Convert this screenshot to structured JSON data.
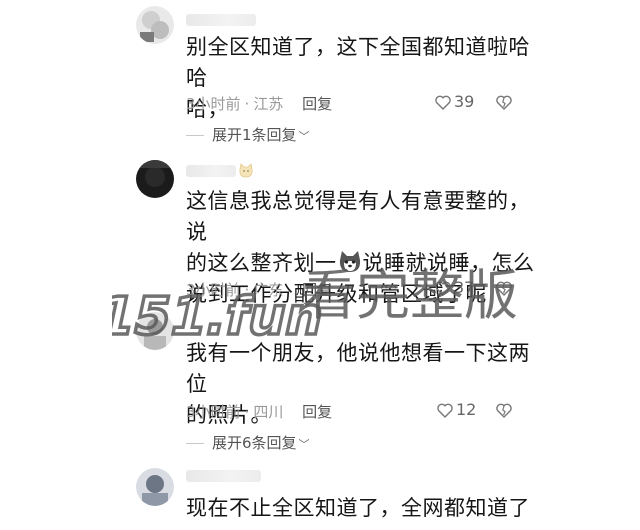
{
  "comments": [
    {
      "text_lines": [
        "别全区知道了，这下全国都知道啦哈哈",
        "哈，"
      ],
      "time": "3小时前",
      "location": "江苏",
      "reply_label": "回复",
      "likes": "39",
      "expand_label": "展开1条回复"
    },
    {
      "text_lines": [
        "这信息我总觉得是有人有意要整的，说",
        "的这么整齐划一",
        "说睡就说睡，怎么",
        "说到工作分配升级和管区域了呢"
      ],
      "time": "3小时前",
      "location": "广东",
      "reply_label": "回复",
      "likes": "37"
    },
    {
      "text_lines": [
        "我有一个朋友，他说他想看一下这两位",
        "的照片。"
      ],
      "time": "3小时前",
      "location": "四川",
      "reply_label": "回复",
      "likes": "12",
      "expand_label": "展开6条回复"
    },
    {
      "text_lines": [
        "现在不止全区知道了，全网都知道了"
      ]
    }
  ],
  "meta_separator": "·",
  "watermark": {
    "site": "151.fun",
    "slogan": "看完整版"
  },
  "icons": {
    "like": "heart-outline-icon",
    "dislike": "broken-heart-icon",
    "chevron": "chevron-down-icon",
    "sticker": "husky-emoji-icon",
    "badge": "cat-badge-icon"
  },
  "colors": {
    "text": "#161616",
    "meta": "#9a9a9a",
    "watermark": "#5a5a5a"
  }
}
